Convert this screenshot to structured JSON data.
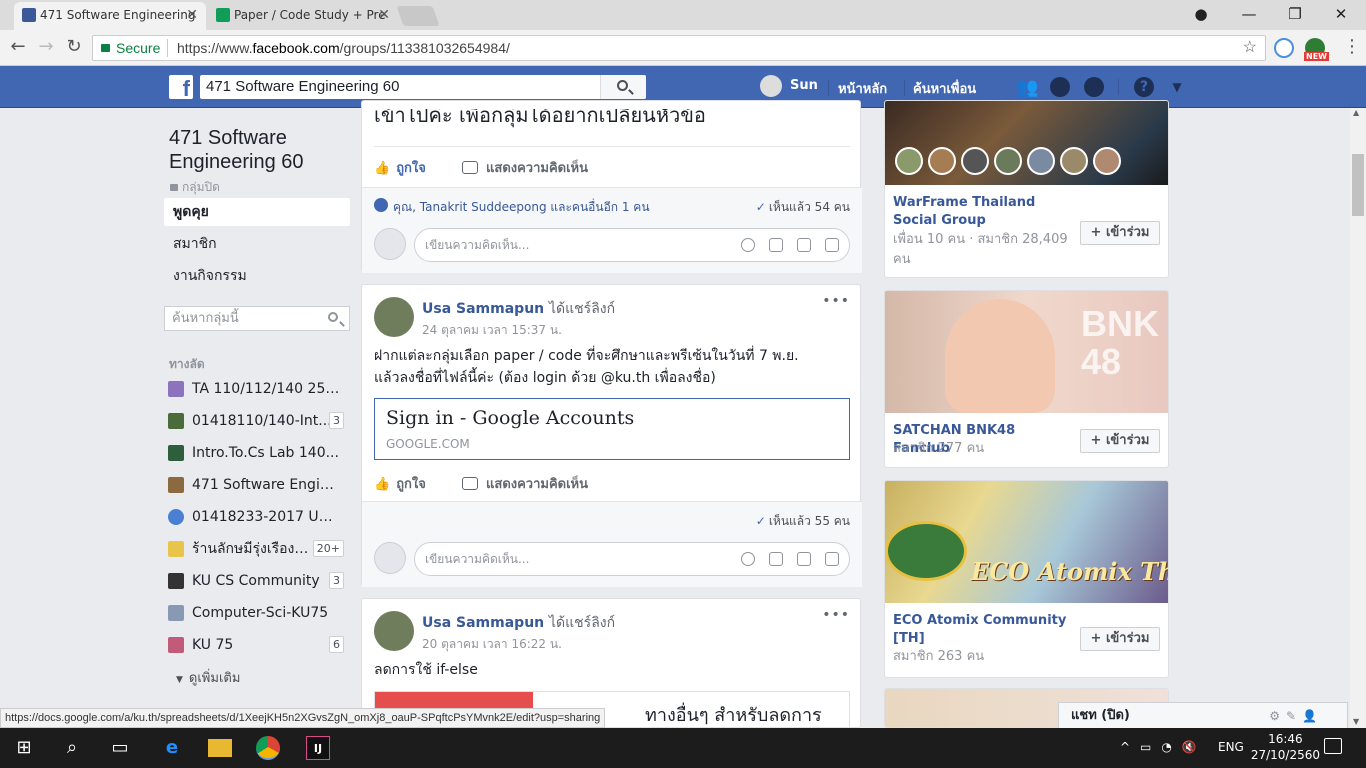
{
  "browser": {
    "tabs": [
      {
        "title": "471 Software Engineering"
      },
      {
        "title": "Paper / Code Study + Pre"
      }
    ],
    "secure_label": "Secure",
    "url_prefix": "https://www.",
    "url_domain": "facebook.com",
    "url_path": "/groups/113381032654984/",
    "status_url": "https://docs.google.com/a/ku.th/spreadsheets/d/1XeejKH5n2XGvsZgN_omXj8_oauP-SPqftcPsYMvnk2E/edit?usp=sharing",
    "ext_badge": "NEW"
  },
  "fb": {
    "logo": "f",
    "search_value": "471 Software Engineering 60",
    "user": "Sun",
    "home": "หน้าหลัก",
    "find_friends": "ค้นหาเพื่อน"
  },
  "group": {
    "title_line1": "471 Software",
    "title_line2": "Engineering 60",
    "privacy": "กลุ่มปิด",
    "nav": [
      "พูดคุย",
      "สมาชิก",
      "งานกิจกรรม"
    ],
    "search_placeholder": "ค้นหากลุ่มนี้",
    "shortcuts_heading": "ทางลัด",
    "shortcuts": [
      {
        "label": "TA 110/112/140 256...",
        "count": "",
        "color": "#8b74bd"
      },
      {
        "label": "01418110/140-Int...",
        "count": "3",
        "color": "#4a6b3a"
      },
      {
        "label": "Intro.To.Cs Lab 140...",
        "count": "",
        "color": "#2e5e3a"
      },
      {
        "label": "471 Software Engin...",
        "count": "",
        "color": "#8a6a3e"
      },
      {
        "label": "01418233-2017 Uni...",
        "count": "",
        "color": "#4a7fd4"
      },
      {
        "label": "ร้านลักษมีรุ่งเรือง ...",
        "count": "20+",
        "color": "#e8c44a"
      },
      {
        "label": "KU CS Community",
        "count": "3",
        "color": "#333333"
      },
      {
        "label": "Computer-Sci-KU75",
        "count": "",
        "color": "#8a99b3"
      },
      {
        "label": "KU 75",
        "count": "6",
        "color": "#c25a7a"
      }
    ],
    "see_more": "ดูเพิ่มเติม"
  },
  "feed": {
    "post0": {
      "partial_text": "เข้าไปค่ะ เพื่อกลุ่มได้อยากเปลี่ยนหัวข้อ",
      "like": "ถูกใจ",
      "comment": "แสดงความคิดเห็น",
      "likes_summary": "คุณ, Tanakrit Suddeepong และคนอื่นอีก 1 คน",
      "seen": "เห็นแล้ว 54 คน",
      "comment_placeholder": "เขียนความคิดเห็น..."
    },
    "post1": {
      "author": "Usa Sammapun",
      "action": "ได้แชร์ลิงก์",
      "time": "24 ตุลาคม เวลา 15:37 น.",
      "text_line1": "ฝากแต่ละกลุ่มเลือก paper / code ที่จะศึกษาและพรีเซ้นในวันที่ 7 พ.ย.",
      "text_line2": "แล้วลงชื่อที่ไฟล์นี้ค่ะ (ต้อง login ด้วย @ku.th เพื่อลงชื่อ)",
      "link_title": "Sign in - Google Accounts",
      "link_domain": "GOOGLE.COM",
      "like": "ถูกใจ",
      "comment": "แสดงความคิดเห็น",
      "seen": "เห็นแล้ว 55 คน",
      "comment_placeholder": "เขียนความคิดเห็น..."
    },
    "post2": {
      "author": "Usa Sammapun",
      "action": "ได้แชร์ลิงก์",
      "time": "20 ตุลาคม เวลา 16:22 น.",
      "text": "ลดการใช้ if-else",
      "link_partial": "ทางอื่นๆ สำหรับลดการ"
    }
  },
  "suggested": [
    {
      "name": "WarFrame Thailand Social Group",
      "meta": "เพื่อน 10 คน · สมาชิก 28,409 คน",
      "join": "เข้าร่วม"
    },
    {
      "name": "SATCHAN BNK48 Fanclub",
      "meta": "สมาชิก 277 คน",
      "join": "เข้าร่วม",
      "img_text": "BNK 48"
    },
    {
      "name": "ECO Atomix Community [TH]",
      "meta": "สมาชิก 263 คน",
      "join": "เข้าร่วม",
      "img_text": "ECO Atomix Thail"
    }
  ],
  "chat": {
    "label": "แชท (ปิด)"
  },
  "taskbar": {
    "lang": "ENG",
    "time": "16:46",
    "date": "27/10/2560"
  }
}
